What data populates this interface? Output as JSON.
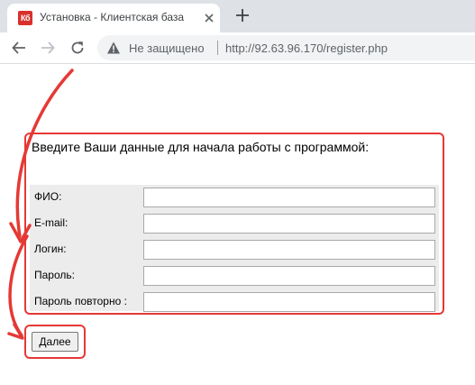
{
  "browser": {
    "tab": {
      "favicon_text": "Кб",
      "title": "Установка - Клиентская база"
    },
    "security_label": "Не защищено",
    "url": "http://92.63.96.170/register.php"
  },
  "page": {
    "intro": "Введите Ваши данные для начала работы с программой:",
    "fields": [
      {
        "label": "ФИО:",
        "value": ""
      },
      {
        "label": "E-mail:",
        "value": ""
      },
      {
        "label": "Логин:",
        "value": ""
      },
      {
        "label": "Пароль:",
        "value": ""
      },
      {
        "label": "Пароль повторно :",
        "value": ""
      }
    ],
    "next_button": "Далее"
  },
  "colors": {
    "annotation": "#e53935",
    "tabstrip": "#dee1e6",
    "form_background": "#ececec"
  }
}
